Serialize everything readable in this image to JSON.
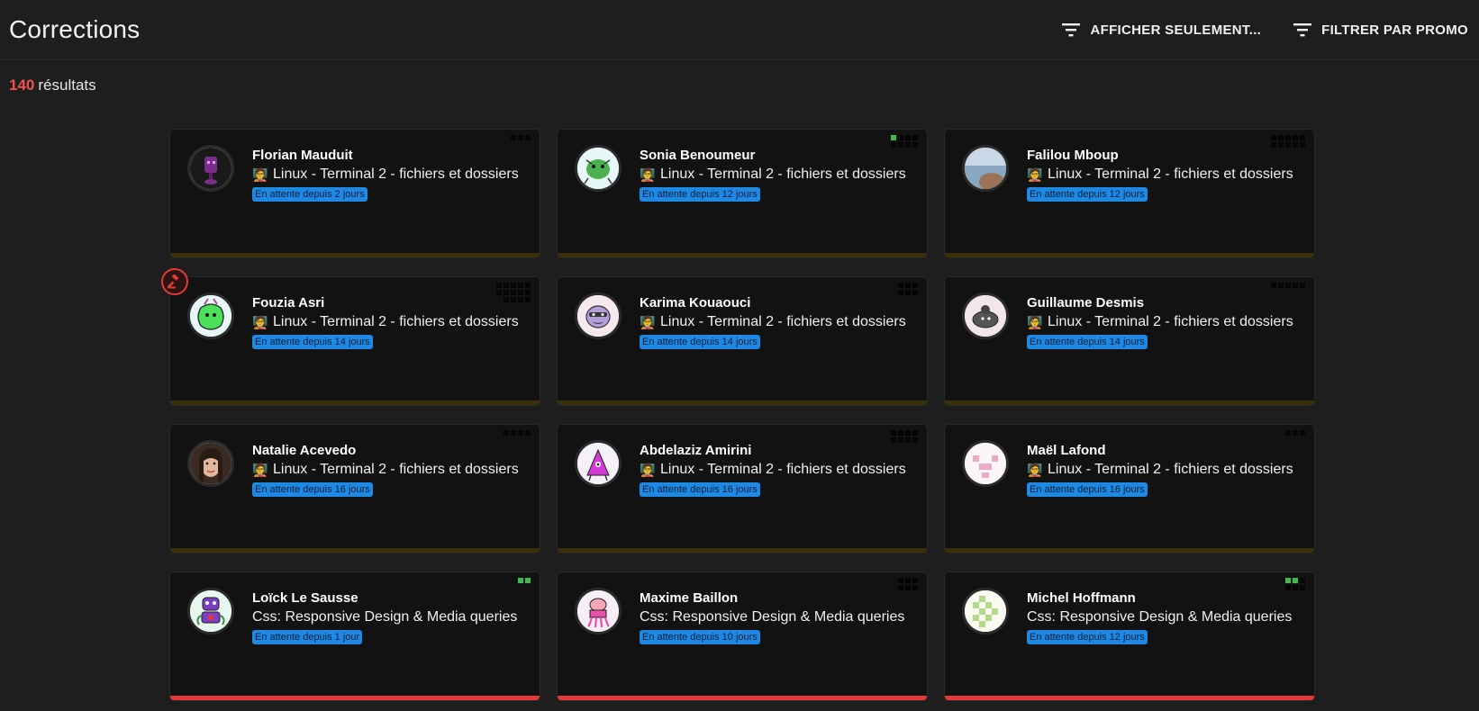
{
  "header": {
    "title": "Corrections",
    "show_only_label": "AFFICHER SEULEMENT...",
    "filter_promo_label": "FILTRER PAR PROMO"
  },
  "results": {
    "count": "140",
    "label": "résultats"
  },
  "colors": {
    "accent_red": "#ef5350",
    "badge_blue": "#1e88e5",
    "bar_brown": "#3b2f0c",
    "bar_red": "#e53935",
    "dot_green": "#3fb950"
  },
  "cards": [
    {
      "name": "Florian Mauduit",
      "exercise": "Linux - Terminal 2 - fichiers et dossiers",
      "icon": "student-emoji-icon",
      "waiting": "En attente depuis 2 jours",
      "avatar": "purple-robot-avatar",
      "squares": [
        0,
        0,
        0
      ],
      "bar": "#3b2f0c",
      "gavel": false
    },
    {
      "name": "Sonia Benoumeur",
      "exercise": "Linux - Terminal 2 - fichiers et dossiers",
      "icon": "student-emoji-icon",
      "waiting": "En attente depuis 12 jours",
      "avatar": "green-bug-avatar",
      "squares": [
        1,
        0,
        0,
        0,
        0,
        0,
        0,
        0
      ],
      "bar": "#3b2f0c",
      "gavel": false
    },
    {
      "name": "Falilou Mboup",
      "exercise": "Linux - Terminal 2 - fichiers et dossiers",
      "icon": "student-emoji-icon",
      "waiting": "En attente depuis 12 jours",
      "avatar": "photo-avatar",
      "squares": [
        0,
        0,
        0,
        0,
        0,
        0,
        0,
        0,
        0,
        0
      ],
      "bar": "#3b2f0c",
      "gavel": false
    },
    {
      "name": "Fouzia Asri",
      "exercise": "Linux - Terminal 2 - fichiers et dossiers",
      "icon": "student-emoji-icon",
      "waiting": "En attente depuis 14 jours",
      "avatar": "green-blob-avatar",
      "squares": [
        0,
        0,
        0,
        0,
        0,
        0,
        0,
        0,
        0,
        0,
        0,
        0,
        0,
        0
      ],
      "bar": "#3b2f0c",
      "gavel": true
    },
    {
      "name": "Karima Kouaouci",
      "exercise": "Linux - Terminal 2 - fichiers et dossiers",
      "icon": "student-emoji-icon",
      "waiting": "En attente depuis 14 jours",
      "avatar": "purple-monster-avatar",
      "squares": [
        0,
        0,
        0,
        0,
        0,
        0
      ],
      "bar": "#3b2f0c",
      "gavel": false
    },
    {
      "name": "Guillaume Desmis",
      "exercise": "Linux - Terminal 2 - fichiers et dossiers",
      "icon": "student-emoji-icon",
      "waiting": "En attente depuis 14 jours",
      "avatar": "grey-creature-avatar",
      "squares": [
        0,
        0,
        0,
        0,
        0
      ],
      "bar": "#3b2f0c",
      "gavel": false
    },
    {
      "name": "Natalie Acevedo",
      "exercise": "Linux - Terminal 2 - fichiers et dossiers",
      "icon": "student-emoji-icon",
      "waiting": "En attente depuis 16 jours",
      "avatar": "photo-woman-avatar",
      "squares": [
        0,
        0,
        0,
        0
      ],
      "bar": "#3b2f0c",
      "gavel": false
    },
    {
      "name": "Abdelaziz Amirini",
      "exercise": "Linux - Terminal 2 - fichiers et dossiers",
      "icon": "student-emoji-icon",
      "waiting": "En attente depuis 16 jours",
      "avatar": "pink-triangle-avatar",
      "squares": [
        0,
        0,
        0,
        0,
        0,
        0,
        0,
        0
      ],
      "bar": "#3b2f0c",
      "gavel": false
    },
    {
      "name": "Maël Lafond",
      "exercise": "Linux - Terminal 2 - fichiers et dossiers",
      "icon": "student-emoji-icon",
      "waiting": "En attente depuis 16 jours",
      "avatar": "pink-pixel-avatar",
      "squares": [
        0,
        0,
        0
      ],
      "bar": "#3b2f0c",
      "gavel": false
    },
    {
      "name": "Loïck Le Sausse",
      "exercise": "Css: Responsive Design & Media queries",
      "icon": "",
      "waiting": "En attente depuis 1 jour",
      "avatar": "purple-robot-2-avatar",
      "squares": [
        1,
        1
      ],
      "bar": "#e53935",
      "gavel": false
    },
    {
      "name": "Maxime Baillon",
      "exercise": "Css: Responsive Design & Media queries",
      "icon": "",
      "waiting": "En attente depuis 10 jours",
      "avatar": "pink-octopus-avatar",
      "squares": [
        0,
        0,
        0,
        0,
        0,
        0
      ],
      "bar": "#e53935",
      "gavel": false
    },
    {
      "name": "Michel Hoffmann",
      "exercise": "Css: Responsive Design & Media queries",
      "icon": "",
      "waiting": "En attente depuis 12 jours",
      "avatar": "green-pixel-avatar",
      "squares": [
        1,
        1,
        0,
        0,
        0,
        0
      ],
      "bar": "#e53935",
      "gavel": false
    }
  ]
}
